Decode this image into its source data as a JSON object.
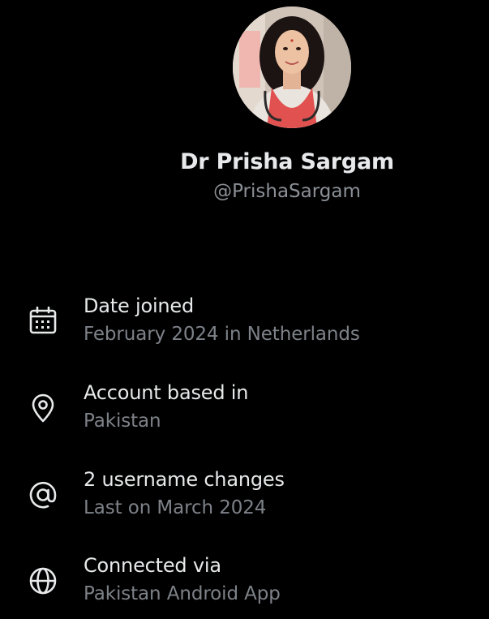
{
  "profile": {
    "display_name": "Dr Prisha Sargam",
    "handle": "@PrishaSargam",
    "avatar": "profile-photo"
  },
  "details": [
    {
      "icon": "calendar-icon",
      "label": "Date joined",
      "value": "February 2024 in Netherlands"
    },
    {
      "icon": "location-pin-icon",
      "label": "Account based in",
      "value": "Pakistan"
    },
    {
      "icon": "at-sign-icon",
      "label": "2 username changes",
      "value": "Last on March 2024"
    },
    {
      "icon": "globe-icon",
      "label": "Connected via",
      "value": "Pakistan Android App"
    }
  ],
  "colors": {
    "background": "#000000",
    "primary_text": "#e7e9ea",
    "secondary_text": "#7d8288"
  }
}
